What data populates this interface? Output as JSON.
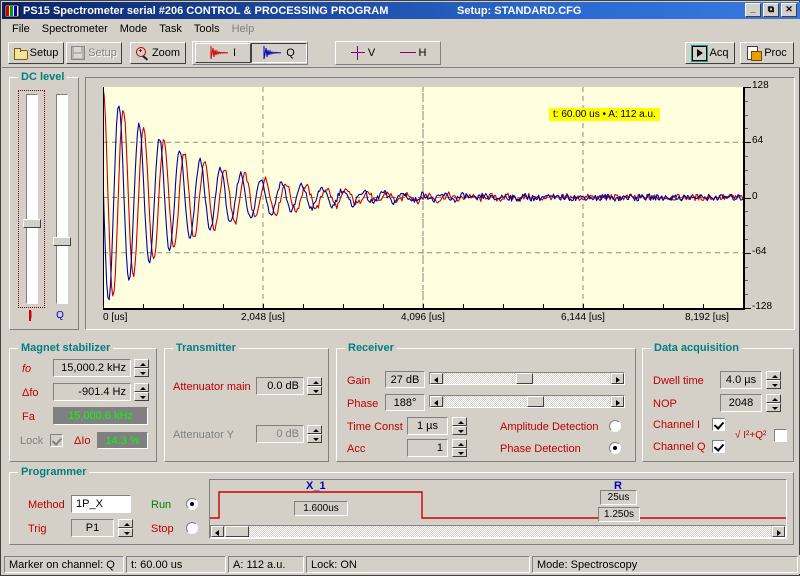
{
  "window": {
    "title_main": "PS15 Spectrometer serial #206   CONTROL & PROCESSING PROGRAM",
    "title_setup": "Setup: STANDARD.CFG",
    "minimize": "_",
    "restore": "⧉",
    "close": "✕"
  },
  "menu": [
    {
      "label": "File",
      "disabled": false
    },
    {
      "label": "Spectrometer",
      "disabled": false
    },
    {
      "label": "Mode",
      "disabled": false
    },
    {
      "label": "Task",
      "disabled": false
    },
    {
      "label": "Tools",
      "disabled": false
    },
    {
      "label": "Help",
      "disabled": true
    }
  ],
  "toolbar": {
    "setup_open": "Setup",
    "setup_save": "Setup",
    "zoom": "Zoom",
    "chan_i": "I",
    "chan_q": "Q",
    "cursor_v": "V",
    "cursor_h": "H",
    "acq": "Acq",
    "proc": "Proc"
  },
  "dc_level": {
    "title": "DC level",
    "label_i": "I",
    "label_q": "Q"
  },
  "magnet": {
    "title": "Magnet stabilizer",
    "fo_label": "fo",
    "fo_value": "15,000.2 kHz",
    "dfo_label": "Δfo",
    "dfo_value": "-901.4 Hz",
    "fa_label": "Fa",
    "fa_value": "15,000.6 kHz",
    "lock_label": "Lock",
    "dio_label": "ΔIo",
    "dio_value": "14.3 %"
  },
  "transmitter": {
    "title": "Transmitter",
    "att_main_label": "Attenuator main",
    "att_main_value": "0.0 dB",
    "att_y_label": "Attenuator Y",
    "att_y_value": "0 dB"
  },
  "receiver": {
    "title": "Receiver",
    "gain_label": "Gain",
    "gain_value": "27 dB",
    "phase_label": "Phase",
    "phase_value": "188°",
    "time_const_label": "Time Const",
    "time_const_value": "1 µs",
    "acc_label": "Acc",
    "acc_value": "1",
    "amplitude_detection": "Amplitude Detection",
    "phase_detection": "Phase Detection"
  },
  "dataacq": {
    "title": "Data acquisition",
    "dwell_label": "Dwell time",
    "dwell_value": "4.0 µs",
    "nop_label": "NOP",
    "nop_value": "2048",
    "chan_i_label": "Channel I",
    "chan_q_label": "Channel Q",
    "magnitude_label": "√ I²+Q²"
  },
  "programmer": {
    "title": "Programmer",
    "method_label": "Method",
    "method_value": "1P_X",
    "trig_label": "Trig",
    "trig_value": "P1",
    "run_label": "Run",
    "stop_label": "Stop",
    "pulse_label": "X_1",
    "pulse_width": "1.600us",
    "relax_label": "R",
    "relax_delay": "25us",
    "repeat_time": "1.250s"
  },
  "statusbar": {
    "marker": "Marker on channel: Q",
    "time": "t: 60.00 us",
    "amp": "A: 112 a.u.",
    "lock": "Lock: ON",
    "mode": "Mode: Spectroscopy"
  },
  "chart_data": {
    "type": "line",
    "title": "",
    "xlabel": "",
    "ylabel": "",
    "xticks": [
      "0 [us]",
      "2,048 [us]",
      "4,096 [us]",
      "6,144 [us]",
      "8,192 [us]"
    ],
    "xtick_values": [
      0,
      2048,
      4096,
      6144,
      8192
    ],
    "yticks": [
      "128",
      "64",
      "0",
      "-64",
      "-128"
    ],
    "ytick_values": [
      128,
      64,
      0,
      -64,
      -128
    ],
    "xlim": [
      0,
      8192
    ],
    "ylim": [
      -128,
      128
    ],
    "grid": true,
    "cursor": {
      "label": "t: 60.00 us • A: 112 a.u.",
      "t": 60.0,
      "a": 112,
      "x_position_us": 4096
    },
    "series": [
      {
        "name": "I",
        "color": "#cc0000",
        "model": "damped_cosine",
        "amplitude": 128,
        "decay_us": 1150,
        "period_us": 260,
        "phase_deg": 0,
        "offset": 0
      },
      {
        "name": "Q",
        "color": "#0000a0",
        "model": "damped_cosine",
        "amplitude": 128,
        "decay_us": 1150,
        "period_us": 260,
        "phase_deg": 78,
        "offset": 0
      }
    ]
  }
}
